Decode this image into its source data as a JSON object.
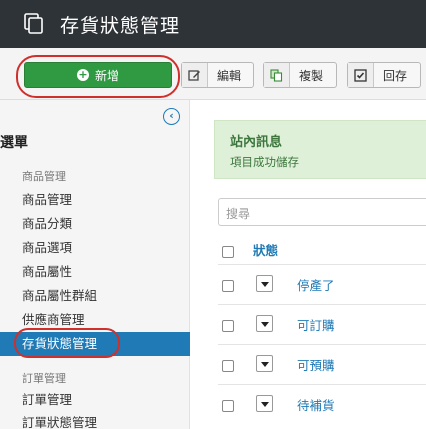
{
  "header": {
    "title": "存貨狀態管理",
    "icon": "copy-icon"
  },
  "toolbar": {
    "new_label": "新增",
    "edit_label": "編輯",
    "copy_label": "複製",
    "save_label": "回存"
  },
  "sidebar": {
    "menu_title": "選單",
    "group_product": "商品管理",
    "items": [
      {
        "label": "商品管理"
      },
      {
        "label": "商品分類"
      },
      {
        "label": "商品選項"
      },
      {
        "label": "商品屬性"
      },
      {
        "label": "商品屬性群組"
      },
      {
        "label": "供應商管理"
      },
      {
        "label": "存貨狀態管理",
        "active": true
      }
    ],
    "group_order": "訂單管理",
    "order_items": [
      {
        "label": "訂單管理"
      },
      {
        "label": "訂單狀態管理"
      }
    ]
  },
  "notice": {
    "title": "站內訊息",
    "message": "項目成功儲存"
  },
  "search": {
    "placeholder": "搜尋"
  },
  "table": {
    "status_header": "狀態",
    "rows": [
      {
        "status": "停產了"
      },
      {
        "status": "可訂購"
      },
      {
        "status": "可預購"
      },
      {
        "status": "待補貨"
      }
    ]
  },
  "colors": {
    "accent": "#1f7ab5",
    "new_button": "#2f9a41",
    "topbar": "#2e3338",
    "highlight_ring": "#d0302c"
  }
}
